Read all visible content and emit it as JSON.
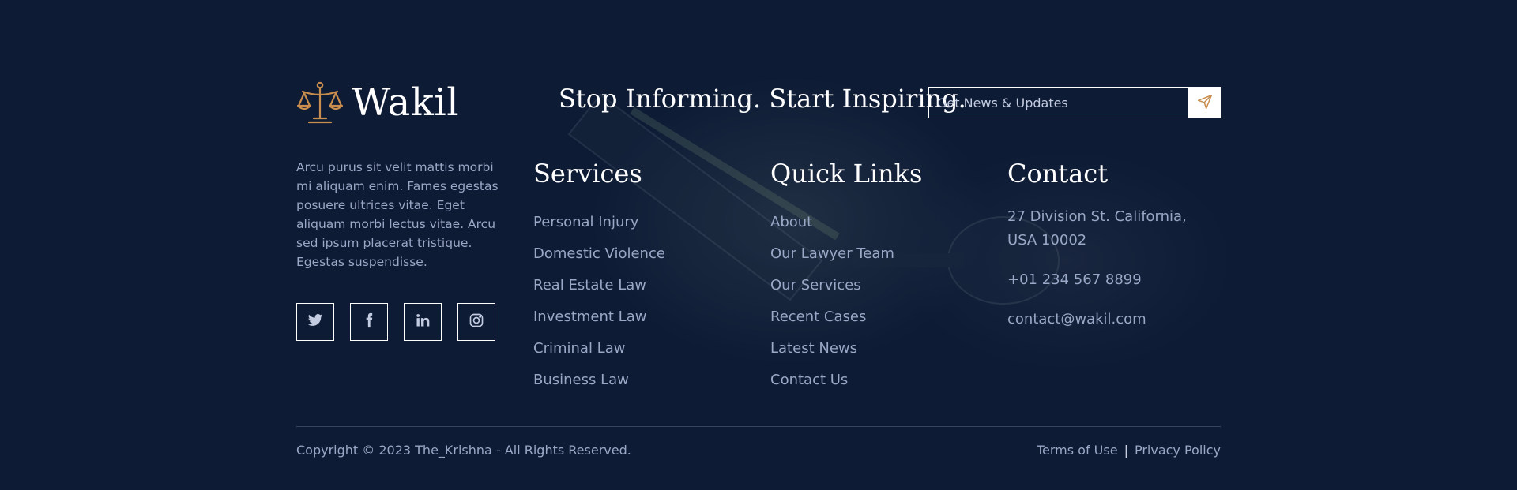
{
  "brand": {
    "name": "Wakil",
    "logo_icon": "scales-of-justice-icon",
    "accent_color": "#c98d4e"
  },
  "tagline": "Stop Informing. Start Inspiring.",
  "newsletter": {
    "placeholder": "Get News & Updates",
    "submit_icon": "paper-plane-icon"
  },
  "about": {
    "text": "Arcu purus sit velit mattis morbi mi aliquam enim. Fames egestas posuere ultrices vitae. Eget aliquam morbi lectus vitae. Arcu sed ipsum placerat tristique. Egestas suspendisse."
  },
  "socials": [
    {
      "icon": "twitter-icon"
    },
    {
      "icon": "facebook-icon"
    },
    {
      "icon": "linkedin-icon"
    },
    {
      "icon": "instagram-icon"
    }
  ],
  "services": {
    "title": "Services",
    "items": [
      "Personal Injury",
      "Domestic Violence",
      "Real Estate Law",
      "Investment Law",
      "Criminal Law",
      "Business Law"
    ]
  },
  "quick_links": {
    "title": "Quick Links",
    "items": [
      "About",
      "Our Lawyer Team",
      "Our Services",
      "Recent Cases",
      "Latest News",
      "Contact Us"
    ]
  },
  "contact": {
    "title": "Contact",
    "address_line1": "27 Division St. California,",
    "address_line2": "USA 10002",
    "phone": "+01 234 567 8899",
    "email": "contact@wakil.com"
  },
  "bottom": {
    "copyright": "Copyright © 2023 The_Krishna - All Rights Reserved.",
    "terms": "Terms of Use",
    "separator": "|",
    "privacy": "Privacy Policy"
  },
  "colors": {
    "background": "#0d1b35",
    "text_muted": "#9ba7c6",
    "heading": "#ffffff"
  }
}
